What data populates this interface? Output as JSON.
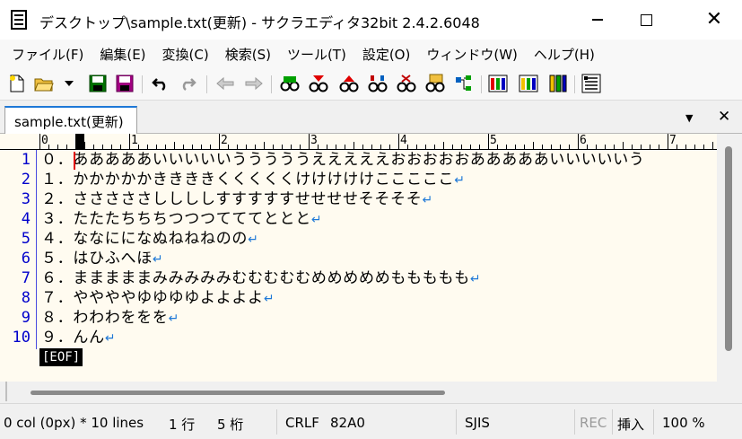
{
  "window": {
    "title": "デスクトップ\\sample.txt(更新) - サクラエディタ32bit 2.4.2.6048"
  },
  "menu": [
    "ファイル(F)",
    "編集(E)",
    "変換(C)",
    "検索(S)",
    "ツール(T)",
    "設定(O)",
    "ウィンドウ(W)",
    "ヘルプ(H)"
  ],
  "tab": {
    "label": "sample.txt(更新)"
  },
  "ruler": {
    "labels": [
      "0",
      "1",
      "2",
      "3",
      "4",
      "5",
      "6",
      "7"
    ]
  },
  "lines": [
    {
      "no": "1",
      "text": "０．あああああいいいいいうううううえええええおおおおおあああああいいいいいう",
      "eol": false
    },
    {
      "no": "2",
      "text": "１．かかかかかききききくくくくくけけけけけこここここ",
      "eol": true
    },
    {
      "no": "3",
      "text": "２．さささささししししすすすすすせせせせそそそそ",
      "eol": true
    },
    {
      "no": "4",
      "text": "３．たたたちちちつつつてててととと",
      "eol": true
    },
    {
      "no": "5",
      "text": "４．ななにになぬねねねのの",
      "eol": true
    },
    {
      "no": "6",
      "text": "５．はひふへほ",
      "eol": true
    },
    {
      "no": "7",
      "text": "６．まままままみみみみみむむむむむめめめめめももももも",
      "eol": true
    },
    {
      "no": "8",
      "text": "７．ややややゆゆゆゆよよよよ",
      "eol": true
    },
    {
      "no": "9",
      "text": "８．わわわををを",
      "eol": true
    },
    {
      "no": "10",
      "text": "９．んん",
      "eol": true
    }
  ],
  "eol_mark": "↵",
  "eof_mark": "[EOF]",
  "status": {
    "position": "0 col (0px) * 10 lines",
    "line": "1 行",
    "col": "5 桁",
    "eol_type": "CRLF",
    "char_code": "82A0",
    "encoding": "SJIS",
    "rec": "REC",
    "insert_mode": "挿入",
    "zoom": "100 %"
  },
  "colors": {
    "editor_bg": "#fffbf0",
    "line_number": "#0000cc",
    "caret": "#e00000",
    "eol_mark": "#1e78d7"
  }
}
